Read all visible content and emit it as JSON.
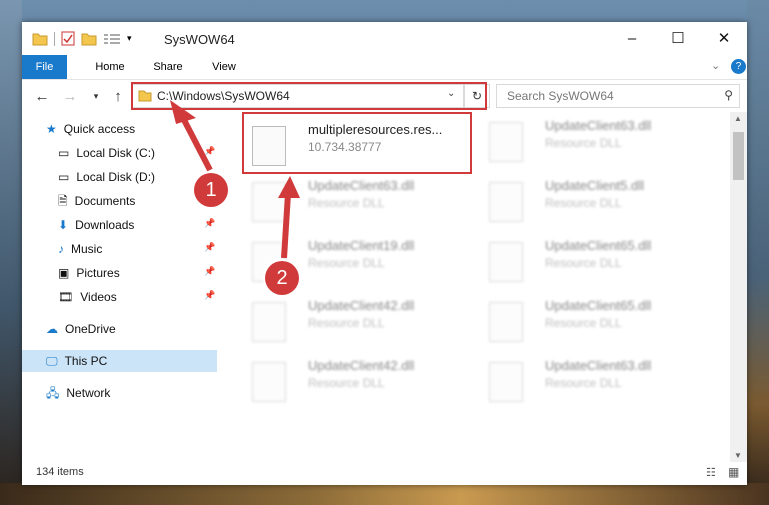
{
  "window": {
    "title": "SysWOW64",
    "minimize": "–",
    "maximize": "☐",
    "close": "✕"
  },
  "ribbon": {
    "tabs": [
      "File",
      "Home",
      "Share",
      "View"
    ]
  },
  "address": {
    "path": "C:\\Windows\\SysWOW64",
    "search_placeholder": "Search SysWOW64"
  },
  "nav": {
    "quick_access": "Quick access",
    "items": [
      "Local Disk (C:)",
      "Local Disk (D:)",
      "Documents",
      "Downloads",
      "Music",
      "Pictures",
      "Videos"
    ],
    "onedrive": "OneDrive",
    "this_pc": "This PC",
    "network": "Network"
  },
  "files": [
    {
      "name": "multipleresources.res...",
      "sub": "10.734.38777"
    },
    {
      "name": "UpdateClient63.dll",
      "sub": "Resource DLL"
    },
    {
      "name": "UpdateClient63.dll",
      "sub": "Resource DLL"
    },
    {
      "name": "UpdateClient5.dll",
      "sub": "Resource DLL"
    },
    {
      "name": "UpdateClient19.dll",
      "sub": "Resource DLL"
    },
    {
      "name": "UpdateClient65.dll",
      "sub": "Resource DLL"
    },
    {
      "name": "UpdateClient42.dll",
      "sub": "Resource DLL"
    },
    {
      "name": "UpdateClient65.dll",
      "sub": "Resource DLL"
    },
    {
      "name": "UpdateClient42.dll",
      "sub": "Resource DLL"
    },
    {
      "name": "UpdateClient63.dll",
      "sub": "Resource DLL"
    }
  ],
  "status": {
    "count": "134 items"
  },
  "annotations": {
    "one": "1",
    "two": "2"
  },
  "colors": {
    "accent": "#1979ca",
    "highlight": "#d13a3a",
    "selection": "#cce4f7"
  }
}
